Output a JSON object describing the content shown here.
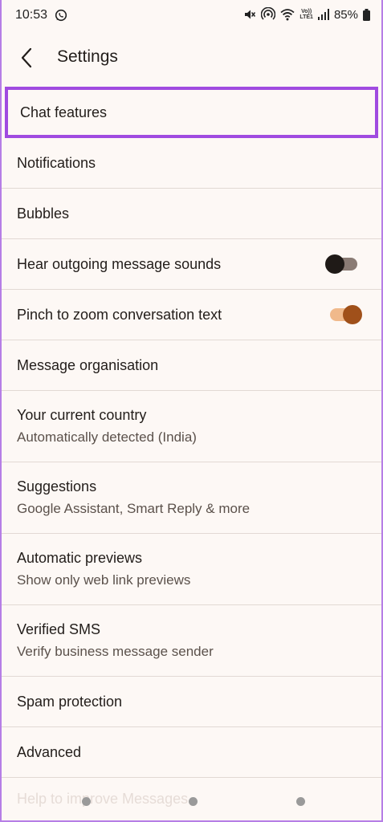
{
  "status_bar": {
    "time": "10:53",
    "battery": "85%",
    "volte_top": "Vo))",
    "volte_bottom": "LTE1"
  },
  "app_bar": {
    "title": "Settings"
  },
  "settings": {
    "items": [
      {
        "title": "Chat features"
      },
      {
        "title": "Notifications"
      },
      {
        "title": "Bubbles"
      },
      {
        "title": "Hear outgoing message sounds",
        "toggle": "off"
      },
      {
        "title": "Pinch to zoom conversation text",
        "toggle": "on"
      },
      {
        "title": "Message organisation"
      },
      {
        "title": "Your current country",
        "subtitle": "Automatically detected (India)"
      },
      {
        "title": "Suggestions",
        "subtitle": "Google Assistant, Smart Reply & more"
      },
      {
        "title": "Automatic previews",
        "subtitle": "Show only web link previews"
      },
      {
        "title": "Verified SMS",
        "subtitle": "Verify business message sender"
      },
      {
        "title": "Spam protection"
      },
      {
        "title": "Advanced"
      }
    ],
    "partially_hidden_item": "Help to improve Messages"
  },
  "colors": {
    "highlight_border": "#a04be0",
    "toggle_on_track": "#f0b98b",
    "toggle_on_knob": "#a0501a",
    "toggle_off_knob": "#1f1a17"
  },
  "icons": [
    "whatsapp-icon",
    "mute-icon",
    "hotspot-icon",
    "wifi-icon",
    "signal-icon",
    "battery-icon",
    "back-arrow-icon"
  ]
}
